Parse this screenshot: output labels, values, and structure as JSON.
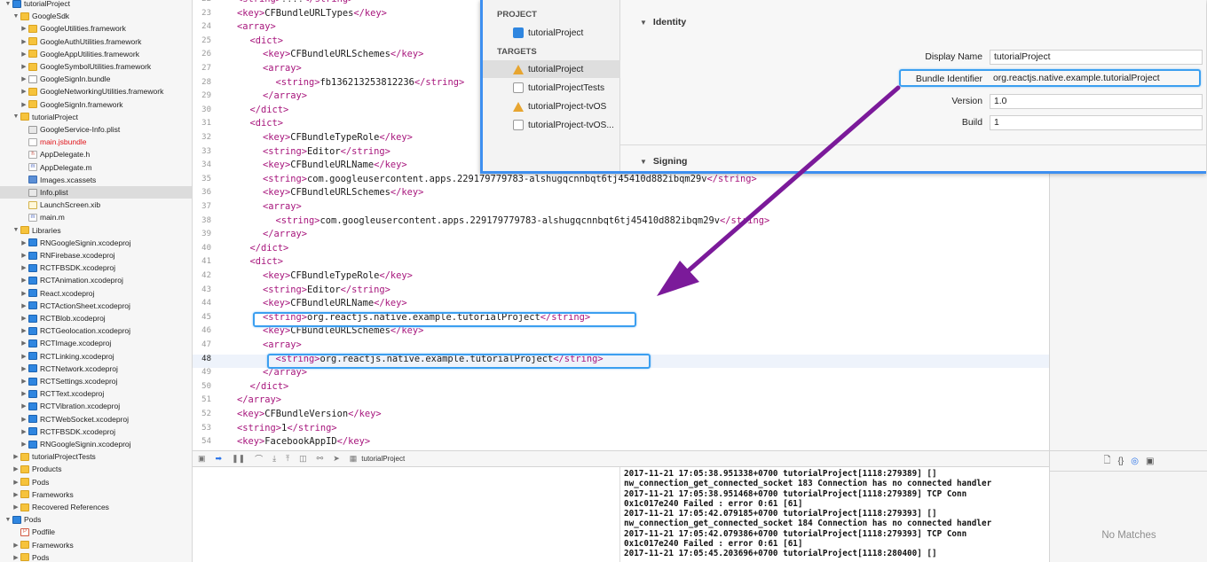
{
  "navigator": {
    "items": [
      {
        "label": "tutorialProject",
        "indent": 0,
        "disc": "▼",
        "icon": "proj"
      },
      {
        "label": "GoogleSdk",
        "indent": 1,
        "disc": "▼",
        "icon": "folder"
      },
      {
        "label": "GoogleUtilities.framework",
        "indent": 2,
        "disc": "▶",
        "icon": "folder"
      },
      {
        "label": "GoogleAuthUtilities.framework",
        "indent": 2,
        "disc": "▶",
        "icon": "folder"
      },
      {
        "label": "GoogleAppUtilities.framework",
        "indent": 2,
        "disc": "▶",
        "icon": "folder"
      },
      {
        "label": "GoogleSymbolUtilities.framework",
        "indent": 2,
        "disc": "▶",
        "icon": "folder"
      },
      {
        "label": "GoogleSignIn.bundle",
        "indent": 2,
        "disc": "▶",
        "icon": "bundle"
      },
      {
        "label": "GoogleNetworkingUtilities.framework",
        "indent": 2,
        "disc": "▶",
        "icon": "folder"
      },
      {
        "label": "GoogleSignIn.framework",
        "indent": 2,
        "disc": "▶",
        "icon": "folder"
      },
      {
        "label": "tutorialProject",
        "indent": 1,
        "disc": "▼",
        "icon": "folder"
      },
      {
        "label": "GoogleService-Info.plist",
        "indent": 2,
        "disc": "",
        "icon": "plist"
      },
      {
        "label": "main.jsbundle",
        "indent": 2,
        "disc": "",
        "icon": "js",
        "red": true
      },
      {
        "label": "AppDelegate.h",
        "indent": 2,
        "disc": "",
        "icon": "h"
      },
      {
        "label": "AppDelegate.m",
        "indent": 2,
        "disc": "",
        "icon": "m"
      },
      {
        "label": "Images.xcassets",
        "indent": 2,
        "disc": "",
        "icon": "assets"
      },
      {
        "label": "Info.plist",
        "indent": 2,
        "disc": "",
        "icon": "plist",
        "selected": true
      },
      {
        "label": "LaunchScreen.xib",
        "indent": 2,
        "disc": "",
        "icon": "xib"
      },
      {
        "label": "main.m",
        "indent": 2,
        "disc": "",
        "icon": "m"
      },
      {
        "label": "Libraries",
        "indent": 1,
        "disc": "▼",
        "icon": "folder"
      },
      {
        "label": "RNGoogleSignin.xcodeproj",
        "indent": 2,
        "disc": "▶",
        "icon": "proj"
      },
      {
        "label": "RNFirebase.xcodeproj",
        "indent": 2,
        "disc": "▶",
        "icon": "proj"
      },
      {
        "label": "RCTFBSDK.xcodeproj",
        "indent": 2,
        "disc": "▶",
        "icon": "proj"
      },
      {
        "label": "RCTAnimation.xcodeproj",
        "indent": 2,
        "disc": "▶",
        "icon": "proj"
      },
      {
        "label": "React.xcodeproj",
        "indent": 2,
        "disc": "▶",
        "icon": "proj"
      },
      {
        "label": "RCTActionSheet.xcodeproj",
        "indent": 2,
        "disc": "▶",
        "icon": "proj"
      },
      {
        "label": "RCTBlob.xcodeproj",
        "indent": 2,
        "disc": "▶",
        "icon": "proj"
      },
      {
        "label": "RCTGeolocation.xcodeproj",
        "indent": 2,
        "disc": "▶",
        "icon": "proj"
      },
      {
        "label": "RCTImage.xcodeproj",
        "indent": 2,
        "disc": "▶",
        "icon": "proj"
      },
      {
        "label": "RCTLinking.xcodeproj",
        "indent": 2,
        "disc": "▶",
        "icon": "proj"
      },
      {
        "label": "RCTNetwork.xcodeproj",
        "indent": 2,
        "disc": "▶",
        "icon": "proj"
      },
      {
        "label": "RCTSettings.xcodeproj",
        "indent": 2,
        "disc": "▶",
        "icon": "proj"
      },
      {
        "label": "RCTText.xcodeproj",
        "indent": 2,
        "disc": "▶",
        "icon": "proj"
      },
      {
        "label": "RCTVibration.xcodeproj",
        "indent": 2,
        "disc": "▶",
        "icon": "proj"
      },
      {
        "label": "RCTWebSocket.xcodeproj",
        "indent": 2,
        "disc": "▶",
        "icon": "proj"
      },
      {
        "label": "RCTFBSDK.xcodeproj",
        "indent": 2,
        "disc": "▶",
        "icon": "proj"
      },
      {
        "label": "RNGoogleSignin.xcodeproj",
        "indent": 2,
        "disc": "▶",
        "icon": "proj"
      },
      {
        "label": "tutorialProjectTests",
        "indent": 1,
        "disc": "▶",
        "icon": "folder"
      },
      {
        "label": "Products",
        "indent": 1,
        "disc": "▶",
        "icon": "folder"
      },
      {
        "label": "Pods",
        "indent": 1,
        "disc": "▶",
        "icon": "folder"
      },
      {
        "label": "Frameworks",
        "indent": 1,
        "disc": "▶",
        "icon": "folder"
      },
      {
        "label": "Recovered References",
        "indent": 1,
        "disc": "▶",
        "icon": "folder"
      },
      {
        "label": "Pods",
        "indent": 0,
        "disc": "▼",
        "icon": "proj"
      },
      {
        "label": "Podfile",
        "indent": 1,
        "disc": "",
        "icon": "pod"
      },
      {
        "label": "Frameworks",
        "indent": 1,
        "disc": "▶",
        "icon": "folder"
      },
      {
        "label": "Pods",
        "indent": 1,
        "disc": "▶",
        "icon": "folder"
      }
    ]
  },
  "editor": {
    "current_line": 48,
    "lines": [
      {
        "n": "22",
        "indent": 1,
        "segs": [
          [
            "t",
            "<string>"
          ],
          [
            "p",
            "????"
          ],
          [
            "t",
            "</string>"
          ]
        ]
      },
      {
        "n": "23",
        "indent": 1,
        "segs": [
          [
            "t",
            "<key>"
          ],
          [
            "p",
            "CFBundleURLTypes"
          ],
          [
            "t",
            "</key>"
          ]
        ]
      },
      {
        "n": "24",
        "indent": 1,
        "segs": [
          [
            "t",
            "<array>"
          ]
        ]
      },
      {
        "n": "25",
        "indent": 2,
        "segs": [
          [
            "t",
            "<dict>"
          ]
        ]
      },
      {
        "n": "26",
        "indent": 3,
        "segs": [
          [
            "t",
            "<key>"
          ],
          [
            "p",
            "CFBundleURLSchemes"
          ],
          [
            "t",
            "</key>"
          ]
        ]
      },
      {
        "n": "27",
        "indent": 3,
        "segs": [
          [
            "t",
            "<array>"
          ]
        ]
      },
      {
        "n": "28",
        "indent": 4,
        "segs": [
          [
            "t",
            "<string>"
          ],
          [
            "p",
            "fb136213253812236"
          ],
          [
            "t",
            "</string>"
          ]
        ]
      },
      {
        "n": "29",
        "indent": 3,
        "segs": [
          [
            "t",
            "</array>"
          ]
        ]
      },
      {
        "n": "30",
        "indent": 2,
        "segs": [
          [
            "t",
            "</dict>"
          ]
        ]
      },
      {
        "n": "31",
        "indent": 2,
        "segs": [
          [
            "t",
            "<dict>"
          ]
        ]
      },
      {
        "n": "32",
        "indent": 3,
        "segs": [
          [
            "t",
            "<key>"
          ],
          [
            "p",
            "CFBundleTypeRole"
          ],
          [
            "t",
            "</key>"
          ]
        ]
      },
      {
        "n": "33",
        "indent": 3,
        "segs": [
          [
            "t",
            "<string>"
          ],
          [
            "p",
            "Editor"
          ],
          [
            "t",
            "</string>"
          ]
        ]
      },
      {
        "n": "34",
        "indent": 3,
        "segs": [
          [
            "t",
            "<key>"
          ],
          [
            "p",
            "CFBundleURLName"
          ],
          [
            "t",
            "</key>"
          ]
        ]
      },
      {
        "n": "35",
        "indent": 3,
        "segs": [
          [
            "t",
            "<string>"
          ],
          [
            "p",
            "com.googleusercontent.apps.229179779783-alshugqcnnbqt6tj45410d882ibqm29v"
          ],
          [
            "t",
            "</string>"
          ]
        ]
      },
      {
        "n": "36",
        "indent": 3,
        "segs": [
          [
            "t",
            "<key>"
          ],
          [
            "p",
            "CFBundleURLSchemes"
          ],
          [
            "t",
            "</key>"
          ]
        ]
      },
      {
        "n": "37",
        "indent": 3,
        "segs": [
          [
            "t",
            "<array>"
          ]
        ]
      },
      {
        "n": "38",
        "indent": 4,
        "segs": [
          [
            "t",
            "<string>"
          ],
          [
            "p",
            "com.googleusercontent.apps.229179779783-alshugqcnnbqt6tj45410d882ibqm29v"
          ],
          [
            "t",
            "</string>"
          ]
        ]
      },
      {
        "n": "39",
        "indent": 3,
        "segs": [
          [
            "t",
            "</array>"
          ]
        ]
      },
      {
        "n": "40",
        "indent": 2,
        "segs": [
          [
            "t",
            "</dict>"
          ]
        ]
      },
      {
        "n": "41",
        "indent": 2,
        "segs": [
          [
            "t",
            "<dict>"
          ]
        ]
      },
      {
        "n": "42",
        "indent": 3,
        "segs": [
          [
            "t",
            "<key>"
          ],
          [
            "p",
            "CFBundleTypeRole"
          ],
          [
            "t",
            "</key>"
          ]
        ]
      },
      {
        "n": "43",
        "indent": 3,
        "segs": [
          [
            "t",
            "<string>"
          ],
          [
            "p",
            "Editor"
          ],
          [
            "t",
            "</string>"
          ]
        ]
      },
      {
        "n": "44",
        "indent": 3,
        "segs": [
          [
            "t",
            "<key>"
          ],
          [
            "p",
            "CFBundleURLName"
          ],
          [
            "t",
            "</key>"
          ]
        ]
      },
      {
        "n": "45",
        "indent": 3,
        "segs": [
          [
            "t",
            "<string>"
          ],
          [
            "p",
            "org.reactjs.native.example.tutorialProject"
          ],
          [
            "t",
            "</string>"
          ]
        ]
      },
      {
        "n": "46",
        "indent": 3,
        "segs": [
          [
            "t",
            "<key>"
          ],
          [
            "p",
            "CFBundleURLSchemes"
          ],
          [
            "t",
            "</key>"
          ]
        ]
      },
      {
        "n": "47",
        "indent": 3,
        "segs": [
          [
            "t",
            "<array>"
          ]
        ]
      },
      {
        "n": "48",
        "indent": 4,
        "segs": [
          [
            "t",
            "<string>"
          ],
          [
            "p",
            "org.reactjs.native.example.tutorialProject"
          ],
          [
            "t",
            "</string>"
          ]
        ]
      },
      {
        "n": "49",
        "indent": 3,
        "segs": [
          [
            "t",
            "</array>"
          ]
        ]
      },
      {
        "n": "50",
        "indent": 2,
        "segs": [
          [
            "t",
            "</dict>"
          ]
        ]
      },
      {
        "n": "51",
        "indent": 1,
        "segs": [
          [
            "t",
            "</array>"
          ]
        ]
      },
      {
        "n": "52",
        "indent": 1,
        "segs": [
          [
            "t",
            "<key>"
          ],
          [
            "p",
            "CFBundleVersion"
          ],
          [
            "t",
            "</key>"
          ]
        ]
      },
      {
        "n": "53",
        "indent": 1,
        "segs": [
          [
            "t",
            "<string>"
          ],
          [
            "p",
            "1"
          ],
          [
            "t",
            "</string>"
          ]
        ]
      },
      {
        "n": "54",
        "indent": 1,
        "segs": [
          [
            "t",
            "<key>"
          ],
          [
            "p",
            "FacebookAppID"
          ],
          [
            "t",
            "</key>"
          ]
        ]
      }
    ]
  },
  "debug_bar": {
    "scheme": "tutorialProject"
  },
  "console": {
    "lines": [
      "2017-11-21 17:05:38.951338+0700 tutorialProject[1118:279389] []",
      "nw_connection_get_connected_socket 183 Connection has no connected handler",
      "2017-11-21 17:05:38.951468+0700 tutorialProject[1118:279389] TCP Conn",
      "0x1c017e240 Failed : error 0:61 [61]",
      "2017-11-21 17:05:42.079185+0700 tutorialProject[1118:279393] []",
      "nw_connection_get_connected_socket 184 Connection has no connected handler",
      "2017-11-21 17:05:42.079386+0700 tutorialProject[1118:279393] TCP Conn",
      "0x1c017e240 Failed : error 0:61 [61]",
      "2017-11-21 17:05:45.203696+0700 tutorialProject[1118:280400] []"
    ]
  },
  "library": {
    "no_matches": "No Matches"
  },
  "project_editor": {
    "project_header": "PROJECT",
    "project_name": "tutorialProject",
    "targets_header": "TARGETS",
    "targets": [
      {
        "label": "tutorialProject",
        "icon": "app",
        "selected": true
      },
      {
        "label": "tutorialProjectTests",
        "icon": "test"
      },
      {
        "label": "tutorialProject-tvOS",
        "icon": "app"
      },
      {
        "label": "tutorialProject-tvOS...",
        "icon": "test"
      }
    ],
    "identity_header": "Identity",
    "signing_header": "Signing",
    "fields": [
      {
        "label": "Display Name",
        "value": "tutorialProject"
      },
      {
        "label": "Bundle Identifier",
        "value": "org.reactjs.native.example.tutorialProject"
      },
      {
        "label": "Version",
        "value": "1.0"
      },
      {
        "label": "Build",
        "value": "1"
      }
    ]
  },
  "colors": {
    "tag": "#a7157c",
    "highlight": "#3b9ff0",
    "arrow": "#7b1a9a",
    "selection": "#dcdcdc"
  }
}
